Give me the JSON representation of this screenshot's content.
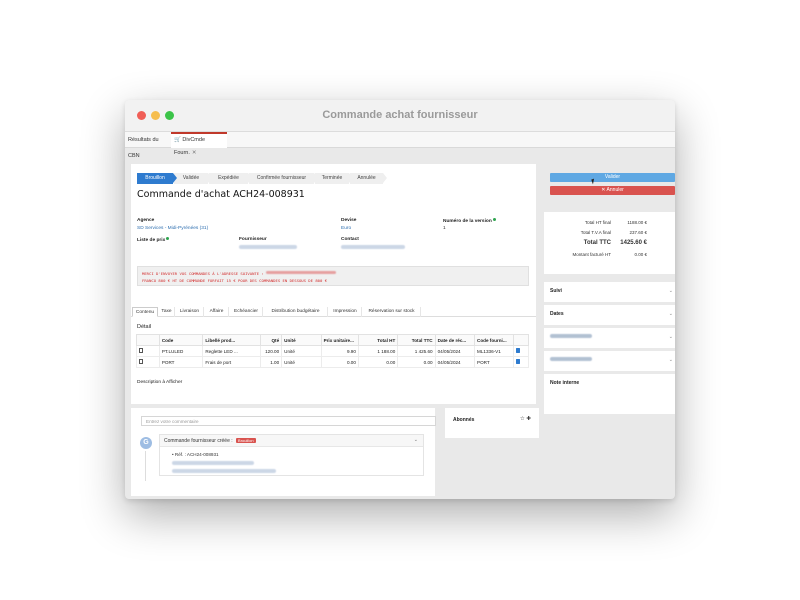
{
  "window": {
    "title": "Commande achat fournisseur"
  },
  "tabs": [
    {
      "label": "Résultats du CBN"
    },
    {
      "label": "DivCmde Fourn."
    }
  ],
  "status_steps": [
    "Brouillon",
    "Validée",
    "Expédiée",
    "Confirmée fournisseur",
    "Terminée",
    "Annulée"
  ],
  "document": {
    "title": "Commande d'achat ACH24-008931",
    "fields": {
      "agence_label": "Agence",
      "agence_value": "SD Services - Midi-Pyrénées (31)",
      "devise_label": "Devise",
      "devise_value": "Euro",
      "version_label": "Numéro de la version",
      "version_value": "1",
      "liste_prix_label": "Liste de prix",
      "fournisseur_label": "Fournisseur",
      "contact_label": "Contact"
    },
    "notice_line1": "MERCI D'ENVOYER VOS COMMANDES À L'ADRESSE SUIVANTE :",
    "notice_line2": "FRANCO 800 € HT DE COMMANDE FORFAIT 15 € POUR DES COMMANDES EN DESSOUS DE 800 €"
  },
  "content_tabs": [
    "Contenu",
    "Taxe",
    "Livraison",
    "Affaire",
    "Echéancier",
    "Distribution budgétaire",
    "Impression",
    "Réservation sur stock"
  ],
  "detail": {
    "title": "Détail",
    "columns": [
      "",
      "Code",
      "Libellé prod...",
      "Qté",
      "Unité",
      "Prix unitaire...",
      "Total HT",
      "Total TTC",
      "Date de réc...",
      "Code fourni...",
      ""
    ],
    "rows": [
      {
        "code": "PT.LULED",
        "libelle": "Reglette LED ...",
        "qte": "120.00",
        "unite": "Unité",
        "pu": "9.90",
        "ht": "1 188.00",
        "ttc": "1 425.60",
        "date": "04/05/2024",
        "code_f": "ML1336-V1"
      },
      {
        "code": "PORT",
        "libelle": "Frais de port",
        "qte": "1.00",
        "unite": "Unité",
        "pu": "0.00",
        "ht": "0.00",
        "ttc": "0.00",
        "date": "04/05/2024",
        "code_f": "PORT"
      }
    ],
    "description_label": "Description à Afficher"
  },
  "actions": {
    "valider": "Valider",
    "annuler": "Annuler"
  },
  "totals": {
    "ht_label": "Total HT final",
    "ht_value": "1188.00 €",
    "tva_label": "Total T.V.A final",
    "tva_value": "237.60 €",
    "ttc_label": "Total TTC",
    "ttc_value": "1425.60 €",
    "facture_label": "Montant facturé HT",
    "facture_value": "0.00 €"
  },
  "accordions": [
    "Suivi",
    "Dates",
    "Références",
    "Caractéristiques",
    "Note interne"
  ],
  "comments": {
    "placeholder": "Entrez votre commentaire",
    "avatar_letter": "G",
    "event_title": "Commande fournisseur créée :",
    "event_badge": "Brouillon",
    "ref_line": "Réf. : ACH24-008931"
  },
  "abonnes": {
    "title": "Abonnés",
    "icons": "☆ ✚"
  }
}
